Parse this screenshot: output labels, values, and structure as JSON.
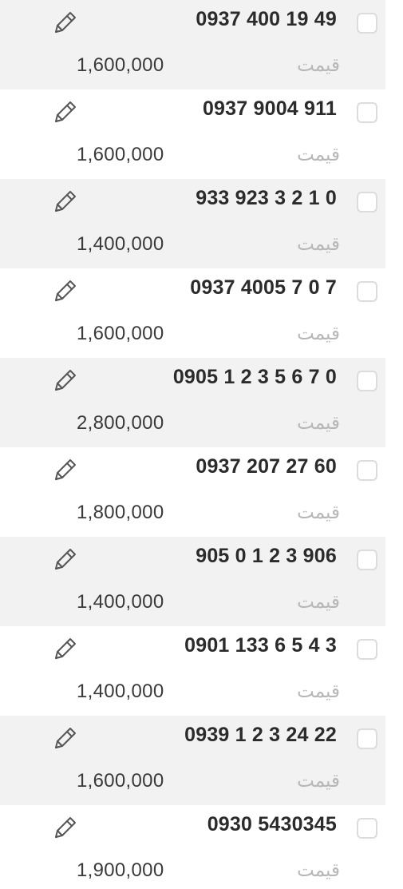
{
  "price_label": "قیمت",
  "items": [
    {
      "number": "0937 400 19 49",
      "price": "1,600,000",
      "shaded": true
    },
    {
      "number": "0937 9004 911",
      "price": "1,600,000",
      "shaded": false
    },
    {
      "number": "933 923 3 2 1 0",
      "price": "1,400,000",
      "shaded": true
    },
    {
      "number": "0937 4005 7 0 7",
      "price": "1,600,000",
      "shaded": false
    },
    {
      "number": "0905 1 2 3 5 6 7 0",
      "price": "2,800,000",
      "shaded": true
    },
    {
      "number": "0937 207 27 60",
      "price": "1,800,000",
      "shaded": false
    },
    {
      "number": "905 0 1 2 3 906",
      "price": "1,400,000",
      "shaded": true
    },
    {
      "number": "0901 133 6 5 4 3",
      "price": "1,400,000",
      "shaded": false
    },
    {
      "number": "0939 1 2 3 24 22",
      "price": "1,600,000",
      "shaded": true
    },
    {
      "number": "0930 5430345",
      "price": "1,900,000",
      "shaded": false
    }
  ],
  "icons": {
    "edit": "pencil-icon"
  },
  "colors": {
    "shaded_row": "#f2f2f2",
    "plain_row": "#ffffff",
    "number_text": "#2b2b2b",
    "price_text": "#3a3a3a",
    "label_text": "#b7b7b7",
    "checkbox_border": "#dcdcdc"
  }
}
